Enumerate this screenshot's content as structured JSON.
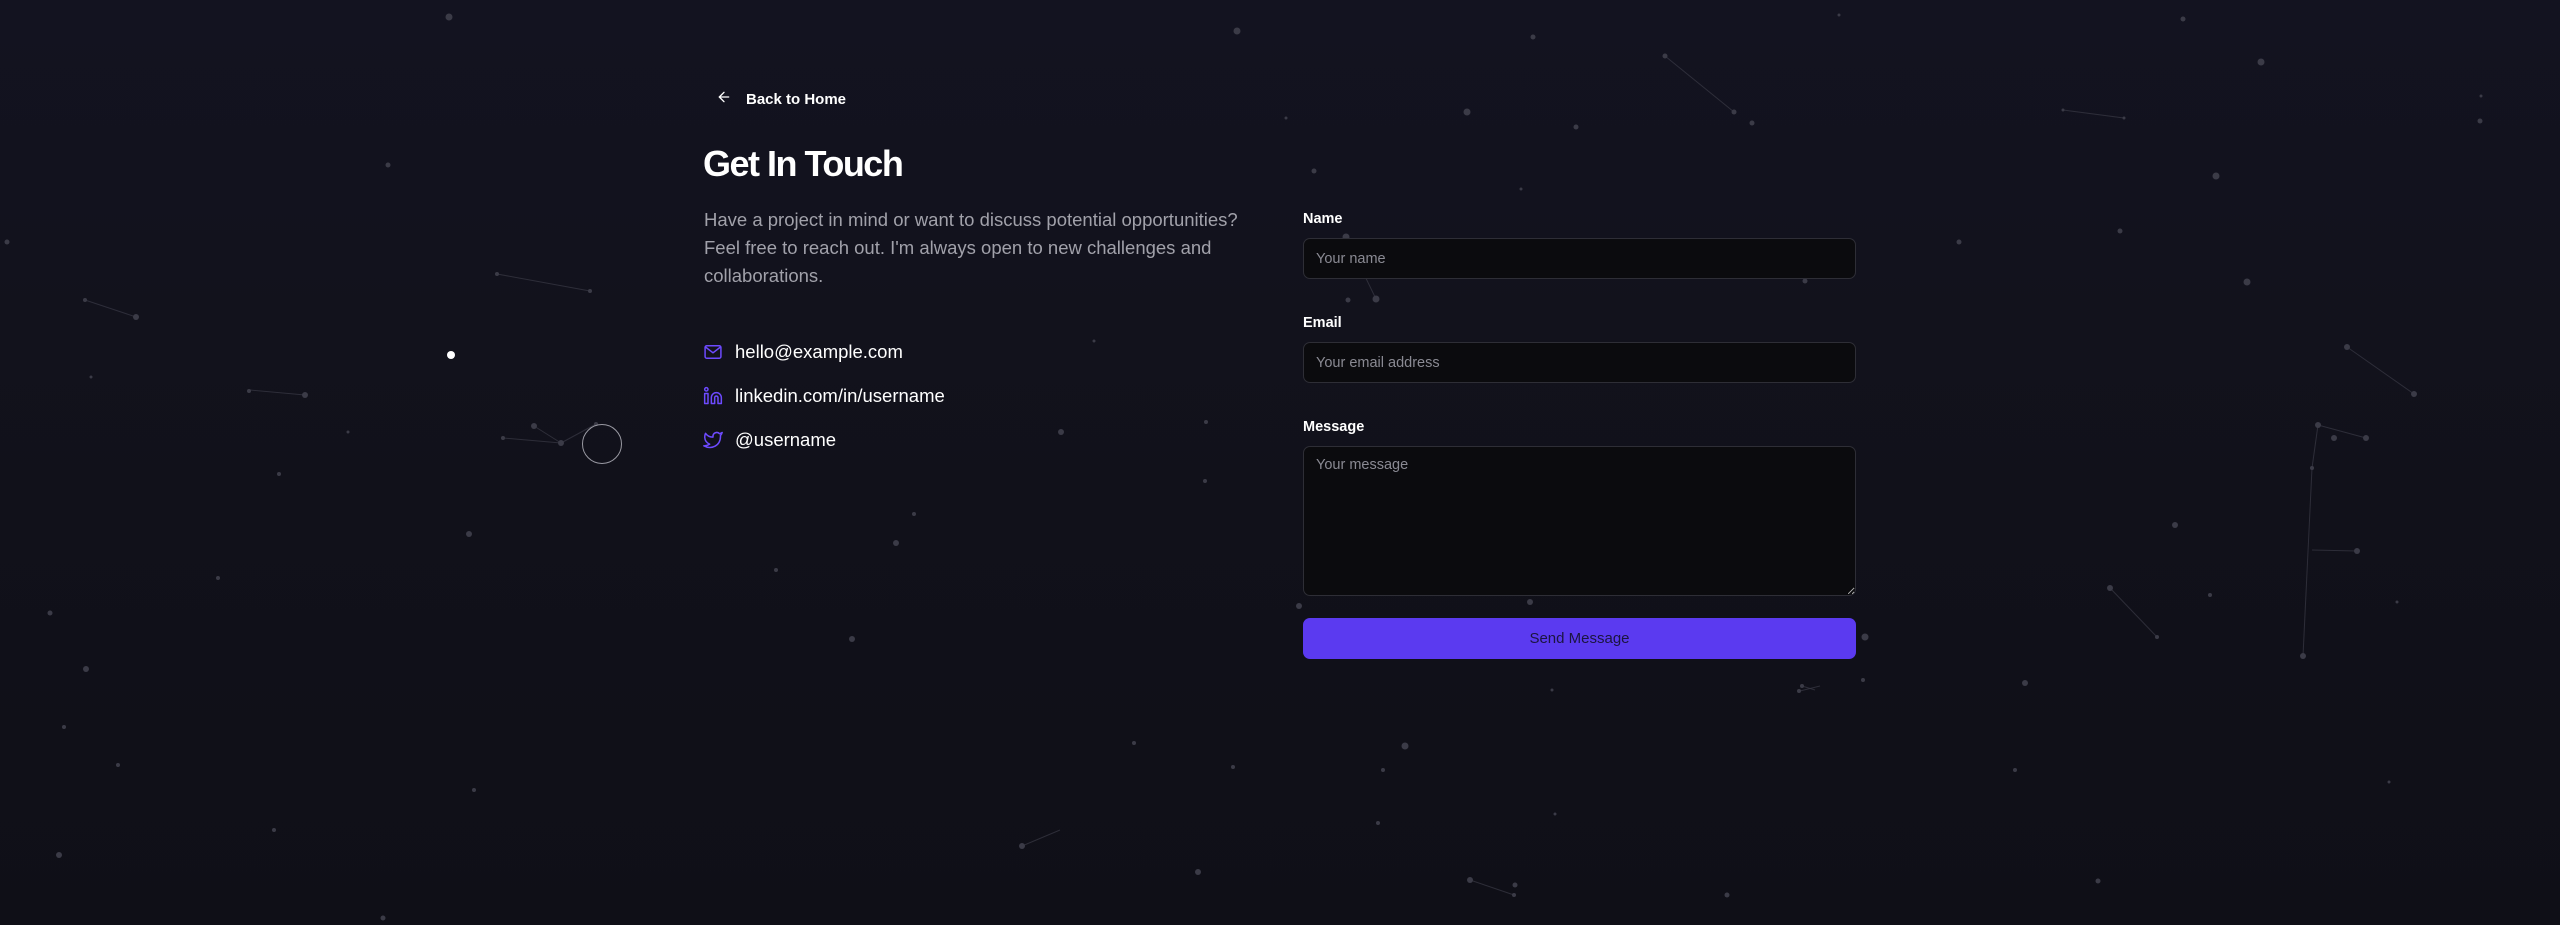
{
  "nav": {
    "back_label": "Back to Home"
  },
  "hero": {
    "title": "Get In Touch",
    "description": "Have a project in mind or want to discuss potential opportunities? Feel free to reach out. I'm always open to new challenges and collaborations."
  },
  "contacts": [
    {
      "icon": "mail-icon",
      "text": "hello@example.com"
    },
    {
      "icon": "linkedin-icon",
      "text": "linkedin.com/in/username"
    },
    {
      "icon": "twitter-icon",
      "text": "@username"
    }
  ],
  "form": {
    "name_label": "Name",
    "name_placeholder": "Your name",
    "email_label": "Email",
    "email_placeholder": "Your email address",
    "message_label": "Message",
    "message_placeholder": "Your message",
    "submit_label": "Send Message"
  },
  "colors": {
    "background": "#12121b",
    "accent": "#5b3af0",
    "icon_accent": "#6d4aff",
    "muted_text": "#a1a1aa",
    "field_bg": "#0b0b0e"
  }
}
